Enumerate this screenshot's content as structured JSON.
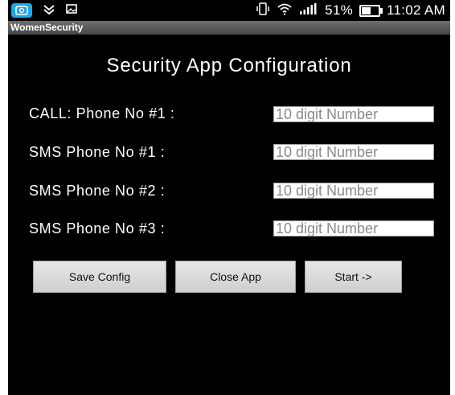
{
  "status_bar": {
    "icons_left": [
      "app-icon",
      "notification-icon",
      "image-icon"
    ],
    "icons_right": [
      "vibrate-icon",
      "wifi-icon",
      "signal-icon"
    ],
    "battery_level": 0.51,
    "battery_text": "51%",
    "time": "11:02 AM"
  },
  "app": {
    "title": "WomenSecurity"
  },
  "main": {
    "heading": "Security App Configuration",
    "rows": [
      {
        "label": "CALL: Phone No #1 :",
        "placeholder": "10 digit Number",
        "value": ""
      },
      {
        "label": "SMS Phone No #1 :",
        "placeholder": "10 digit Number",
        "value": ""
      },
      {
        "label": "SMS Phone No #2 :",
        "placeholder": "10 digit Number",
        "value": ""
      },
      {
        "label": "SMS Phone No #3 :",
        "placeholder": "10 digit Number",
        "value": ""
      }
    ],
    "buttons": {
      "save": "Save Config",
      "close": "Close App",
      "start": "Start ->"
    }
  },
  "colors": {
    "background": "#000000",
    "title_bar": "#5a5a5a",
    "app_icon": "#1fa6e8",
    "button": "#dcdcdc"
  }
}
